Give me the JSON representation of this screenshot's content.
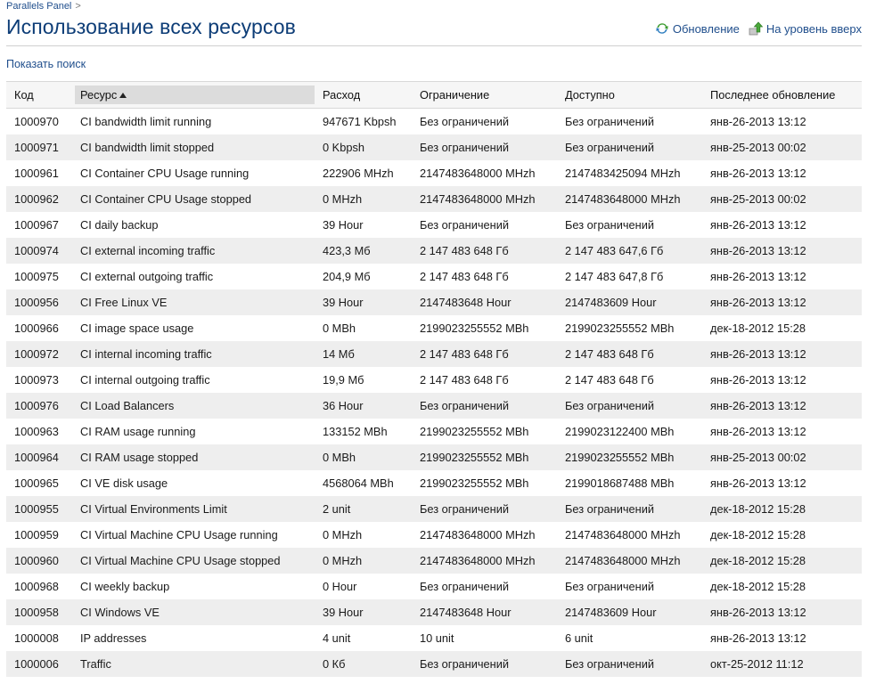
{
  "breadcrumb": {
    "root": "Parallels Panel",
    "separator": ">"
  },
  "page": {
    "title": "Использование всех ресурсов"
  },
  "toolbar": {
    "refresh_label": "Обновление",
    "up_label": "На уровень вверх"
  },
  "search": {
    "toggle_label": "Показать поиск"
  },
  "table": {
    "columns": [
      "Код",
      "Ресурс",
      "Расход",
      "Ограничение",
      "Доступно",
      "Последнее обновление"
    ],
    "sorted_column": "Ресурс",
    "sort_direction": "asc",
    "rows": [
      [
        "1000970",
        "CI bandwidth limit running",
        "947671 Kbpsh",
        "Без ограничений",
        "Без ограничений",
        "янв-26-2013 13:12"
      ],
      [
        "1000971",
        "CI bandwidth limit stopped",
        "0 Kbpsh",
        "Без ограничений",
        "Без ограничений",
        "янв-25-2013 00:02"
      ],
      [
        "1000961",
        "CI Container CPU Usage running",
        "222906 MHzh",
        "2147483648000 MHzh",
        "2147483425094 MHzh",
        "янв-26-2013 13:12"
      ],
      [
        "1000962",
        "CI Container CPU Usage stopped",
        "0 MHzh",
        "2147483648000 MHzh",
        "2147483648000 MHzh",
        "янв-25-2013 00:02"
      ],
      [
        "1000967",
        "CI daily backup",
        "39 Hour",
        "Без ограничений",
        "Без ограничений",
        "янв-26-2013 13:12"
      ],
      [
        "1000974",
        "CI external incoming traffic",
        "423,3 Мб",
        "2 147 483 648 Гб",
        "2 147 483 647,6 Гб",
        "янв-26-2013 13:12"
      ],
      [
        "1000975",
        "CI external outgoing traffic",
        "204,9 Мб",
        "2 147 483 648 Гб",
        "2 147 483 647,8 Гб",
        "янв-26-2013 13:12"
      ],
      [
        "1000956",
        "CI Free Linux VE",
        "39 Hour",
        "2147483648 Hour",
        "2147483609 Hour",
        "янв-26-2013 13:12"
      ],
      [
        "1000966",
        "CI image space usage",
        "0 MBh",
        "2199023255552 MBh",
        "2199023255552 MBh",
        "дек-18-2012 15:28"
      ],
      [
        "1000972",
        "CI internal incoming traffic",
        "14 Мб",
        "2 147 483 648 Гб",
        "2 147 483 648 Гб",
        "янв-26-2013 13:12"
      ],
      [
        "1000973",
        "CI internal outgoing traffic",
        "19,9 Мб",
        "2 147 483 648 Гб",
        "2 147 483 648 Гб",
        "янв-26-2013 13:12"
      ],
      [
        "1000976",
        "CI Load Balancers",
        "36 Hour",
        "Без ограничений",
        "Без ограничений",
        "янв-26-2013 13:12"
      ],
      [
        "1000963",
        "CI RAM usage running",
        "133152 MBh",
        "2199023255552 MBh",
        "2199023122400 MBh",
        "янв-26-2013 13:12"
      ],
      [
        "1000964",
        "CI RAM usage stopped",
        "0 MBh",
        "2199023255552 MBh",
        "2199023255552 MBh",
        "янв-25-2013 00:02"
      ],
      [
        "1000965",
        "CI VE disk usage",
        "4568064 MBh",
        "2199023255552 MBh",
        "2199018687488 MBh",
        "янв-26-2013 13:12"
      ],
      [
        "1000955",
        "CI Virtual Environments Limit",
        "2 unit",
        "Без ограничений",
        "Без ограничений",
        "дек-18-2012 15:28"
      ],
      [
        "1000959",
        "CI Virtual Machine CPU Usage running",
        "0 MHzh",
        "2147483648000 MHzh",
        "2147483648000 MHzh",
        "дек-18-2012 15:28"
      ],
      [
        "1000960",
        "CI Virtual Machine CPU Usage stopped",
        "0 MHzh",
        "2147483648000 MHzh",
        "2147483648000 MHzh",
        "дек-18-2012 15:28"
      ],
      [
        "1000968",
        "CI weekly backup",
        "0 Hour",
        "Без ограничений",
        "Без ограничений",
        "дек-18-2012 15:28"
      ],
      [
        "1000958",
        "CI Windows VE",
        "39 Hour",
        "2147483648 Hour",
        "2147483609 Hour",
        "янв-26-2013 13:12"
      ],
      [
        "1000008",
        "IP addresses",
        "4 unit",
        "10 unit",
        "6 unit",
        "янв-26-2013 13:12"
      ],
      [
        "1000006",
        "Traffic",
        "0 Кб",
        "Без ограничений",
        "Без ограничений",
        "окт-25-2012 11:12"
      ]
    ]
  },
  "colors": {
    "title": "#0d3d77",
    "link": "#1f4e8c",
    "row_alt": "#eeeeee",
    "header_bg": "#f6f6f6",
    "sorted_header_bg": "#dcdcdc",
    "refresh_icon": "#3a9a2e",
    "up_icon": "#4aa83a"
  },
  "icons": {
    "refresh": "refresh-icon",
    "up": "level-up-icon",
    "sort": "sort-ascending-icon"
  }
}
